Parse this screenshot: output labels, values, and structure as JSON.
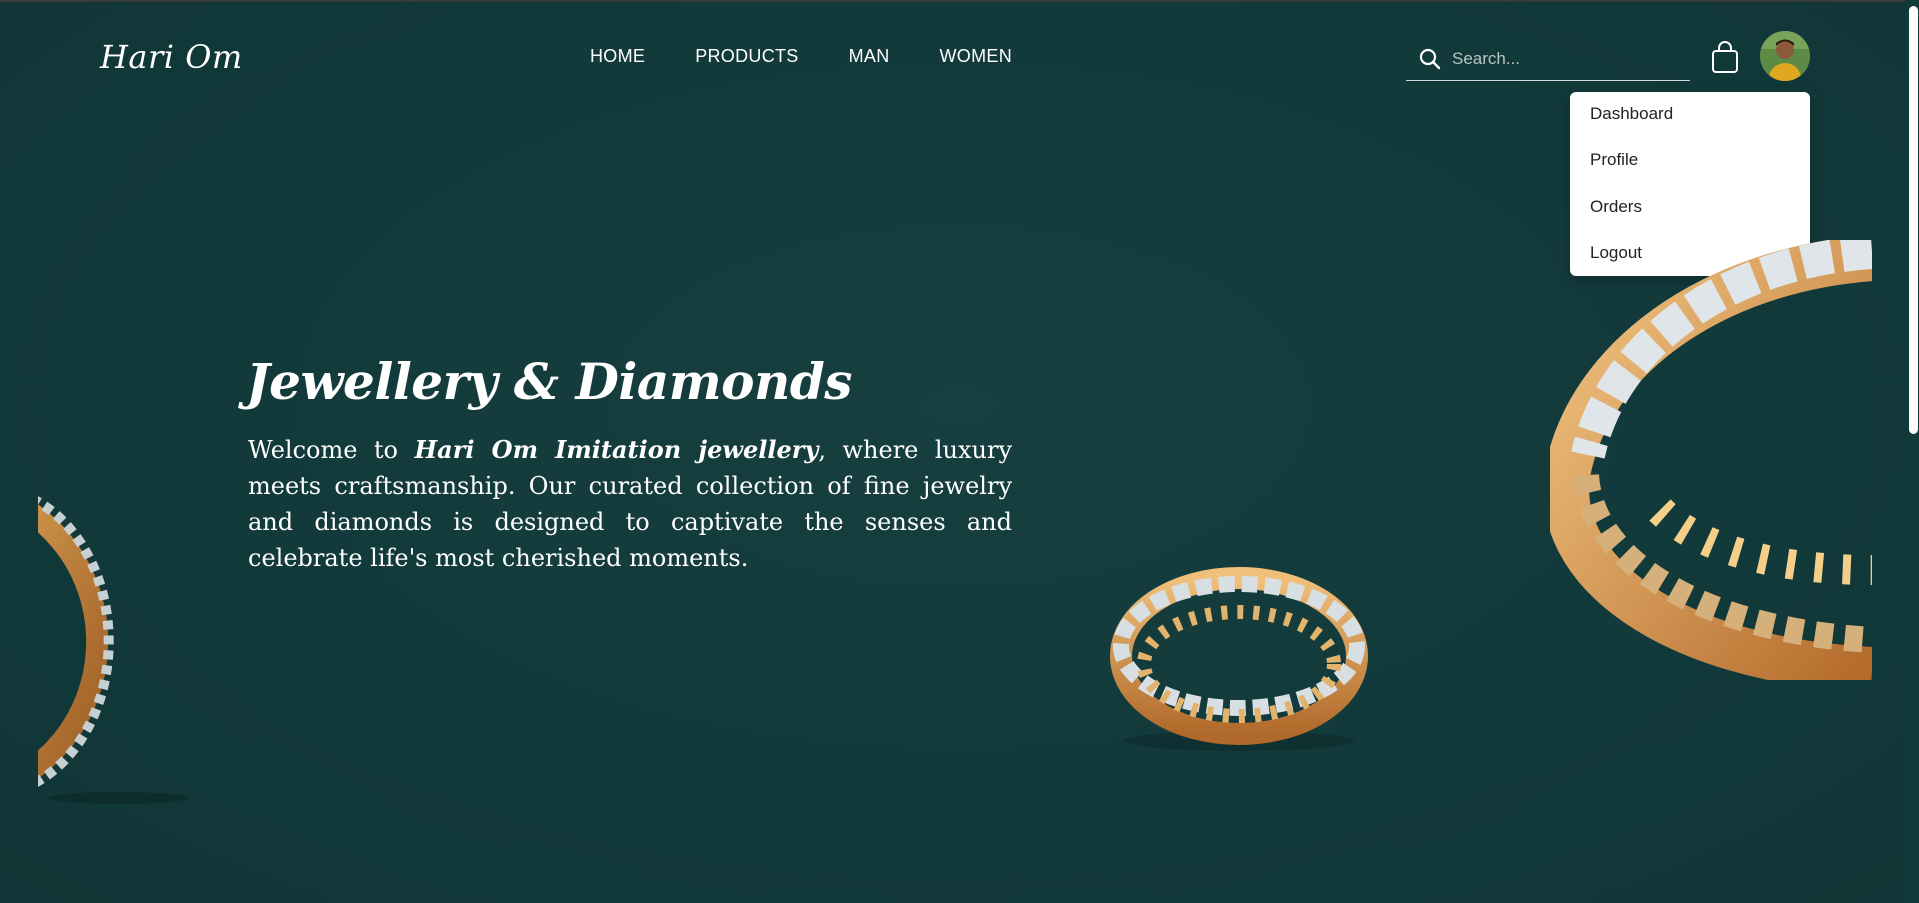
{
  "header": {
    "logo": "Hari Om",
    "nav": [
      "HOME",
      "PRODUCTS",
      "MAN",
      "WOMEN"
    ],
    "search_placeholder": "Search...",
    "icons": {
      "search": "search-icon",
      "bag": "shopping-bag-icon",
      "avatar": "user-avatar"
    }
  },
  "user_menu": {
    "items": [
      "Dashboard",
      "Profile",
      "Orders",
      "Logout"
    ]
  },
  "hero": {
    "title": "Jewellery & Diamonds",
    "text_before": "Welcome to ",
    "brand": "Hari Om Imitation jewellery",
    "text_after": ", where luxury meets craftsmanship. Our curated collection of fine jewelry and diamonds is designed to captivate the senses and celebrate life's most cherished moments."
  },
  "colors": {
    "background": "#123a3b",
    "ring_gold": "#c8893e",
    "text": "#ffffff"
  }
}
